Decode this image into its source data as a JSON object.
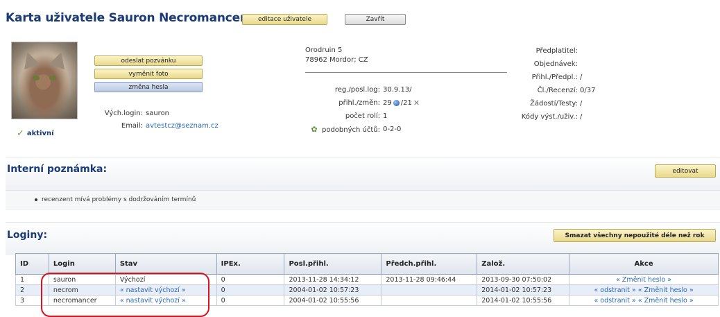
{
  "header": {
    "title": "Karta uživatele Sauron Necromancer",
    "edit_user_label": "editace uživatele",
    "close_label": "Zavřít"
  },
  "profile": {
    "status_label": "aktivní",
    "actions": {
      "send_invite": "odeslat pozvánku",
      "change_photo": "vyměnit foto",
      "change_password": "změna hesla"
    },
    "default_login_key": "Vých.login:",
    "default_login_value": "sauron",
    "email_key": "Email:",
    "email_value": "avtestcz@seznam.cz"
  },
  "address": {
    "line1": "Orodruin 5",
    "line2": "78962 Mordor; CZ"
  },
  "stats": {
    "reg_key": "reg./posl.log:",
    "reg_value": "30.9.13/",
    "login_key": "přihl./změn:",
    "login_count": "29",
    "change_count": "/21",
    "roles_key": "počet rolí:",
    "roles_value": "1",
    "similar_key": "podobných účtů:",
    "similar_value": "0-2-0"
  },
  "subscriptions": {
    "subscriber_key": "Předplatitel:",
    "subscriber_value": "",
    "orders_key": "Objednávek:",
    "orders_value": "",
    "subs_key": "Přihl./Předpl.:",
    "subs_value": "/",
    "articles_key": "Čl./Recenzí:",
    "articles_value": "0/37",
    "requests_key": "Žádostí/Testy:",
    "requests_value": "/",
    "codes_key": "Kódy výst./uživ.:",
    "codes_value": "/"
  },
  "internal_note": {
    "title": "Interní poznámka:",
    "edit_label": "editovat",
    "items": [
      "recenzent mívá problémy s dodržováním termínů"
    ]
  },
  "logins": {
    "title": "Loginy:",
    "delete_unused_label": "Smazat všechny nepoužité déle než rok",
    "columns": [
      "ID",
      "Login",
      "Stav",
      "IPEx.",
      "Posl.přihl.",
      "Předch.přihl.",
      "Založ.",
      "Akce"
    ],
    "rows": [
      {
        "id": "1",
        "login": "sauron",
        "status": "Výchozí",
        "ipex": "0",
        "last_login": "2013-11-28 14:34:12",
        "prev_login": "2013-11-28 09:46:44",
        "created": "2013-09-30 07:50:02",
        "actions": "« Změnit heslo »"
      },
      {
        "id": "2",
        "login": "necrom",
        "status": "« nastavit výchozí »",
        "ipex": "0",
        "last_login": "2004-01-02 10:57:23",
        "prev_login": "",
        "created": "2014-01-02 10:57:23",
        "actions": "« odstranit » « Změnit heslo »"
      },
      {
        "id": "3",
        "login": "necromancer",
        "status": "« nastavit výchozí »",
        "ipex": "0",
        "last_login": "2004-01-02 10:55:56",
        "prev_login": "",
        "created": "2014-01-02 10:55:56",
        "actions": "« odstranit » « Změnit heslo »"
      }
    ]
  },
  "colors": {
    "title_blue": "#1a3a78",
    "link_blue": "#2a6ab8",
    "button_yellow": "#e9d98c",
    "highlight_red": "#d9121c"
  }
}
